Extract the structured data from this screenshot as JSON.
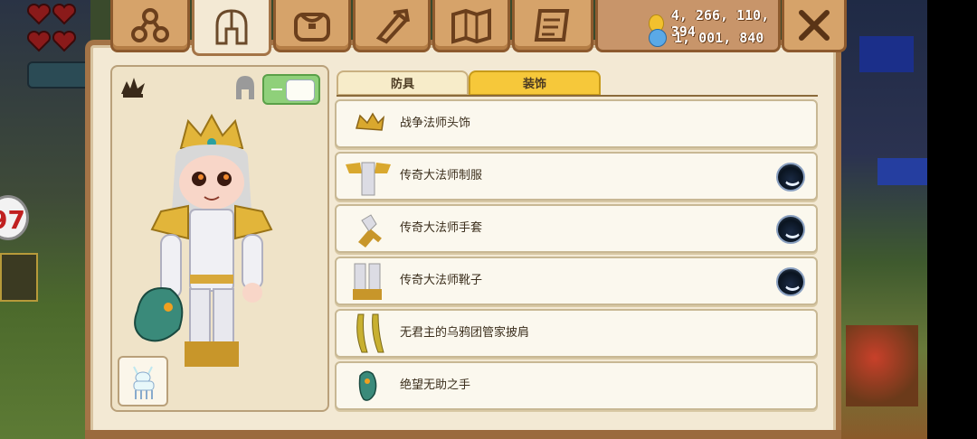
{
  "hud": {
    "left_badge": "97"
  },
  "top_tabs": [
    {
      "name": "hierarchy-icon"
    },
    {
      "name": "helmet-icon",
      "active": true
    },
    {
      "name": "bag-icon"
    },
    {
      "name": "tools-icon"
    },
    {
      "name": "map-icon"
    },
    {
      "name": "scroll-icon"
    }
  ],
  "currency": {
    "gold": "4, 266, 110, 394",
    "gems": "1, 001, 840",
    "gold_color": "#f2c12e",
    "gem_color": "#5aa9e6"
  },
  "preview": {
    "hat_icon": "jester-hat-icon",
    "helmet_visibility_toggle": true,
    "pet": "white-deer-pet"
  },
  "sub_tabs": {
    "armor": "防具",
    "decor": "装饰",
    "active": "decor"
  },
  "items": [
    {
      "name": "战争法师头饰",
      "thumb": "crown-icon",
      "equipped": false
    },
    {
      "name": "传奇大法师制服",
      "thumb": "uniform-icon",
      "equipped": true
    },
    {
      "name": "传奇大法师手套",
      "thumb": "gloves-icon",
      "equipped": true
    },
    {
      "name": "传奇大法师靴子",
      "thumb": "boots-icon",
      "equipped": true
    },
    {
      "name": "无君主的乌鸦团管家披肩",
      "thumb": "shawl-icon",
      "equipped": false
    },
    {
      "name": "绝望无助之手",
      "thumb": "hand-icon",
      "equipped": false
    }
  ]
}
